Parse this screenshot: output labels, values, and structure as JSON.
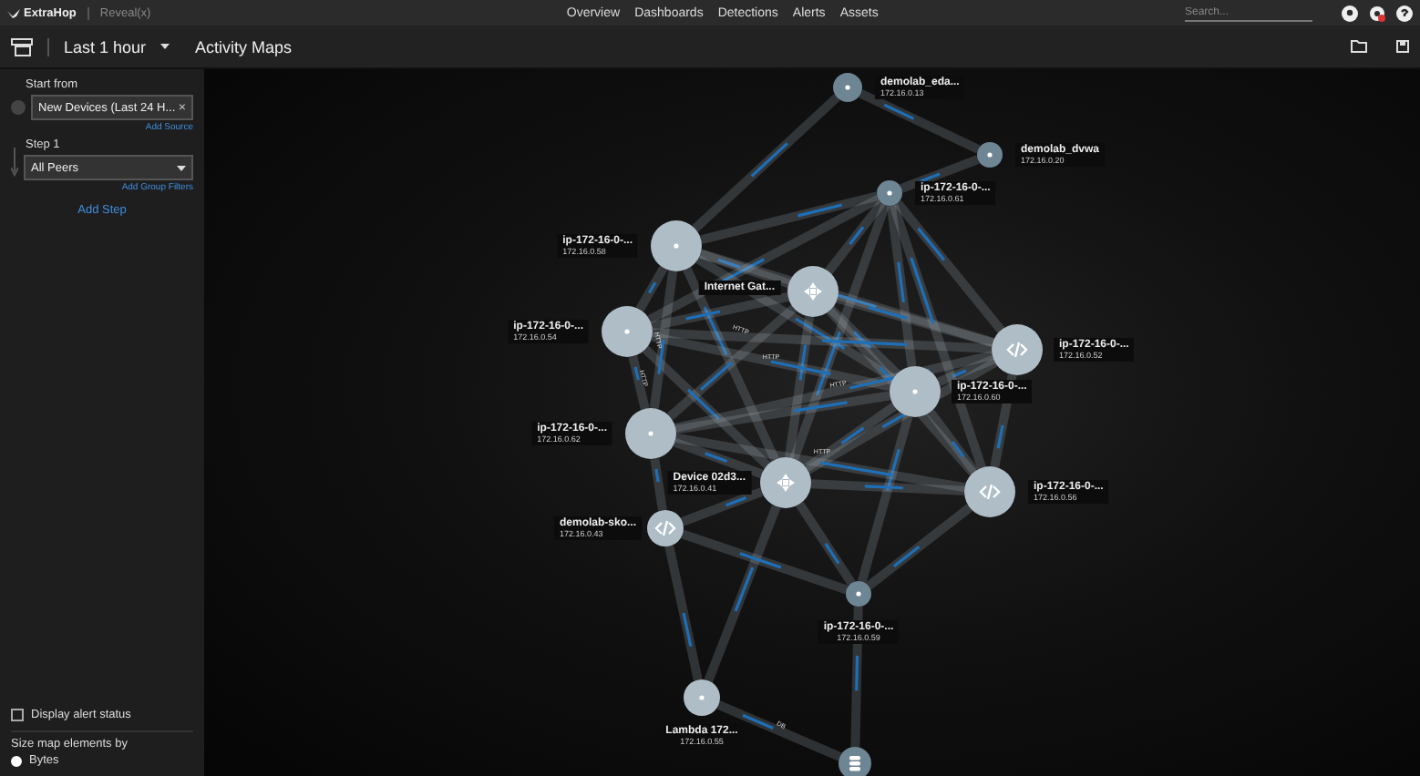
{
  "top_nav": {
    "brand": "ExtraHop",
    "product": "Reveal(x)",
    "links": [
      "Overview",
      "Dashboards",
      "Detections",
      "Alerts",
      "Assets"
    ],
    "search": {
      "placeholder": "Search..."
    }
  },
  "toolbar": {
    "time_range": "Last 1 hour",
    "title": "Activity Maps"
  },
  "sidebar": {
    "start_from": {
      "label": "Start from",
      "value": "New Devices (Last 24 H...",
      "remove": "×",
      "link": "Add Source"
    },
    "step": {
      "label": "Step 1",
      "value": "All Peers",
      "link": "Add Group Filters"
    },
    "add_step": "Add Step",
    "display_alert_status": {
      "label": "Display alert status",
      "checked": false
    },
    "size_by": {
      "label": "Size map elements by",
      "options": [
        {
          "label": "Bytes",
          "selected": true
        }
      ]
    }
  },
  "map": {
    "nodes": [
      {
        "kind": "host",
        "name": "demolab_eda...",
        "address": "172.16.0.13"
      },
      {
        "kind": "host",
        "name": "demolab_dvwa",
        "address": "172.16.0.20"
      },
      {
        "kind": "host",
        "name": "ip-172-16-0-...",
        "address": "172.16.0.61"
      },
      {
        "kind": "host",
        "name": "ip-172-16-0-...",
        "address": "172.16.0.58"
      },
      {
        "kind": "gateway",
        "name": "Internet Gat..."
      },
      {
        "kind": "host",
        "name": "ip-172-16-0-...",
        "address": "172.16.0.54"
      },
      {
        "kind": "code",
        "name": "ip-172-16-0-...",
        "address": "172.16.0.52"
      },
      {
        "kind": "host",
        "name": "ip-172-16-0-...",
        "address": "172.16.0.60"
      },
      {
        "kind": "host",
        "name": "ip-172-16-0-...",
        "address": "172.16.0.62"
      },
      {
        "kind": "gateway",
        "name": "Device 02d3...",
        "address": "172.16.0.41"
      },
      {
        "kind": "code",
        "name": "ip-172-16-0-...",
        "address": "172.16.0.56"
      },
      {
        "kind": "code",
        "name": "demolab-sko...",
        "address": "172.16.0.43"
      },
      {
        "kind": "host",
        "name": "ip-172-16-0-...",
        "address": "172.16.0.59"
      },
      {
        "kind": "host",
        "name": "Lambda 172...",
        "address": "172.16.0.55"
      },
      {
        "kind": "database"
      }
    ],
    "edge_labels": [
      "HTTP",
      "HTTP",
      "HTTP",
      "HTTP",
      "HTTP",
      "HTTP",
      "DB"
    ]
  }
}
